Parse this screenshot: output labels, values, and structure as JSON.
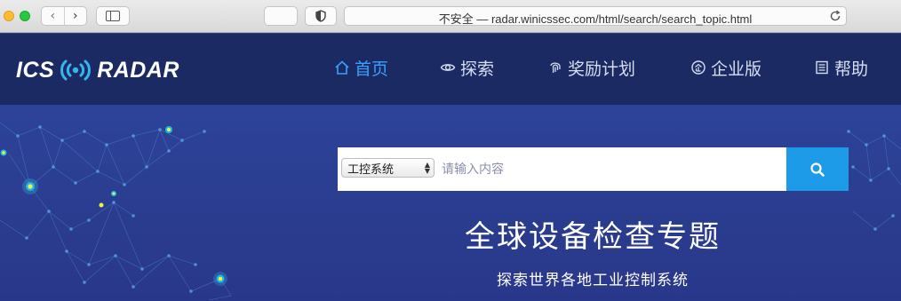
{
  "browser": {
    "url": "不安全 — radar.winicssec.com/html/search/search_topic.html",
    "back_glyph": "‹",
    "forward_glyph": "›"
  },
  "header": {
    "logo_left": "ICS",
    "logo_right": "RADAR",
    "nav": [
      {
        "label": "首页",
        "icon": "home-icon",
        "active": true
      },
      {
        "label": "探索",
        "icon": "eye-icon",
        "active": false
      },
      {
        "label": "奖励计划",
        "icon": "fingerprint-icon",
        "active": false
      },
      {
        "label": "企业版",
        "icon": "enterprise-badge-icon",
        "active": false
      },
      {
        "label": "帮助",
        "icon": "document-list-icon",
        "active": false
      }
    ]
  },
  "search": {
    "category_selected": "工控系统",
    "placeholder": "请输入内容",
    "value": "",
    "button_icon": "search-icon"
  },
  "hero": {
    "title": "全球设备检查专题",
    "subtitle": "探索世界各地工业控制系统"
  },
  "colors": {
    "header_bg": "#1b2a63",
    "hero_bg": "#2d4399",
    "accent": "#1e9be8",
    "active_nav": "#3aa0ff"
  }
}
